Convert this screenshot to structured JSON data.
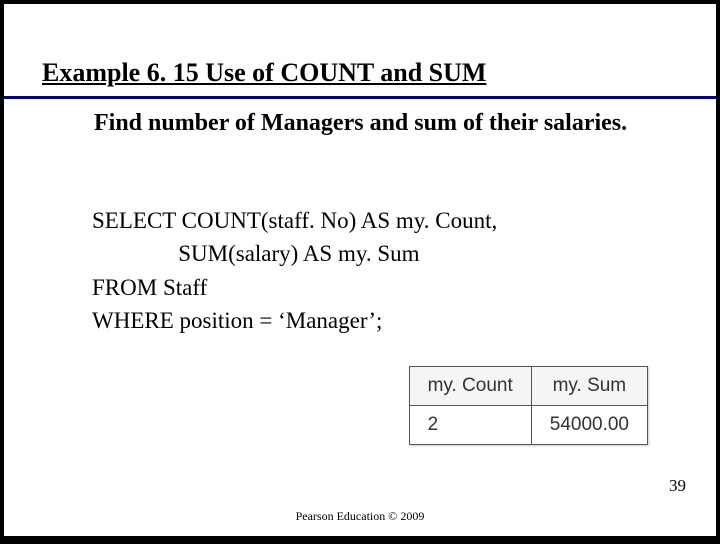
{
  "title": "Example 6. 15  Use of COUNT and SUM",
  "prompt_line1_indent": "",
  "prompt": "Find number of Managers and sum of their salaries.",
  "sql": {
    "l1": "SELECT COUNT(staff. No) AS my. Count,",
    "l2": "               SUM(salary) AS my. Sum",
    "l3": "FROM Staff",
    "l4": "WHERE position = ‘Manager’;"
  },
  "table": {
    "headers": [
      "my. Count",
      "my. Sum"
    ],
    "row": [
      "2",
      "54000.00"
    ]
  },
  "page_number": "39",
  "copyright": "Pearson Education © 2009"
}
